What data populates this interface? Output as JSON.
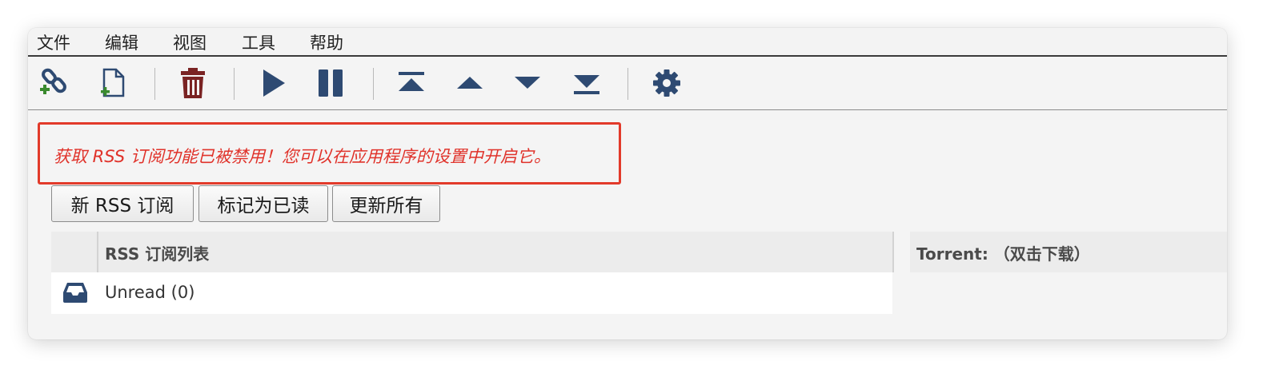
{
  "menu": {
    "file": "文件",
    "edit": "编辑",
    "view": "视图",
    "tools": "工具",
    "help": "帮助"
  },
  "toolbar": {
    "icons": [
      "add-link-icon",
      "add-file-icon",
      "delete-icon",
      "play-icon",
      "pause-icon",
      "move-top-icon",
      "move-up-icon",
      "move-down-icon",
      "move-bottom-icon",
      "settings-icon"
    ],
    "colors": {
      "icon": "#2e4a72",
      "delete": "#7a2323",
      "plus": "#3a8a2e"
    }
  },
  "warning": {
    "text": "获取 RSS 订阅功能已被禁用！您可以在应用程序的设置中开启它。",
    "color": "#e0322a"
  },
  "buttons": {
    "new_feed": "新 RSS 订阅",
    "mark_read": "标记为已读",
    "update_all": "更新所有"
  },
  "feeds": {
    "header": "RSS 订阅列表",
    "items": [
      {
        "icon": "inbox-icon",
        "label": "Unread (0)"
      }
    ]
  },
  "torrents": {
    "header": "Torrent: （双击下载）"
  }
}
